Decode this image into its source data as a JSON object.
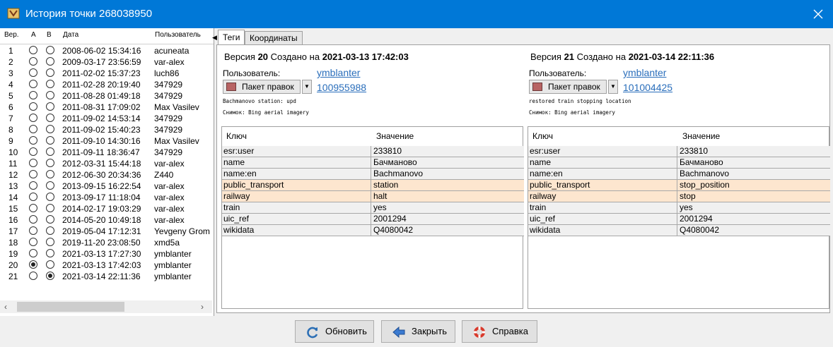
{
  "window": {
    "title": "История точки 268038950"
  },
  "history": {
    "headers": {
      "ver": "Вер.",
      "a": "A",
      "b": "B",
      "date": "Дата",
      "user": "Пользователь"
    },
    "rows": [
      {
        "ver": "1",
        "date": "2008-06-02 15:34:16",
        "user": "acuneata",
        "a": false,
        "b": false
      },
      {
        "ver": "2",
        "date": "2009-03-17 23:56:59",
        "user": "var-alex",
        "a": false,
        "b": false
      },
      {
        "ver": "3",
        "date": "2011-02-02 15:37:23",
        "user": "luch86",
        "a": false,
        "b": false
      },
      {
        "ver": "4",
        "date": "2011-02-28 20:19:40",
        "user": "347929",
        "a": false,
        "b": false
      },
      {
        "ver": "5",
        "date": "2011-08-28 01:49:18",
        "user": "347929",
        "a": false,
        "b": false
      },
      {
        "ver": "6",
        "date": "2011-08-31 17:09:02",
        "user": "Max Vasilev",
        "a": false,
        "b": false
      },
      {
        "ver": "7",
        "date": "2011-09-02 14:53:14",
        "user": "347929",
        "a": false,
        "b": false
      },
      {
        "ver": "8",
        "date": "2011-09-02 15:40:23",
        "user": "347929",
        "a": false,
        "b": false
      },
      {
        "ver": "9",
        "date": "2011-09-10 14:30:16",
        "user": "Max Vasilev",
        "a": false,
        "b": false
      },
      {
        "ver": "10",
        "date": "2011-09-11 18:36:47",
        "user": "347929",
        "a": false,
        "b": false
      },
      {
        "ver": "11",
        "date": "2012-03-31 15:44:18",
        "user": "var-alex",
        "a": false,
        "b": false
      },
      {
        "ver": "12",
        "date": "2012-06-30 20:34:36",
        "user": "Z440",
        "a": false,
        "b": false
      },
      {
        "ver": "13",
        "date": "2013-09-15 16:22:54",
        "user": "var-alex",
        "a": false,
        "b": false
      },
      {
        "ver": "14",
        "date": "2013-09-17 11:18:04",
        "user": "var-alex",
        "a": false,
        "b": false
      },
      {
        "ver": "15",
        "date": "2014-02-17 19:03:29",
        "user": "var-alex",
        "a": false,
        "b": false
      },
      {
        "ver": "16",
        "date": "2014-05-20 10:49:18",
        "user": "var-alex",
        "a": false,
        "b": false
      },
      {
        "ver": "17",
        "date": "2019-05-04 17:12:31",
        "user": "Yevgeny Grom",
        "a": false,
        "b": false
      },
      {
        "ver": "18",
        "date": "2019-11-20 23:08:50",
        "user": "xmd5a",
        "a": false,
        "b": false
      },
      {
        "ver": "19",
        "date": "2021-03-13 17:27:30",
        "user": "ymblanter",
        "a": false,
        "b": false
      },
      {
        "ver": "20",
        "date": "2021-03-13 17:42:03",
        "user": "ymblanter",
        "a": true,
        "b": false
      },
      {
        "ver": "21",
        "date": "2021-03-14 22:11:36",
        "user": "ymblanter",
        "a": false,
        "b": true
      }
    ]
  },
  "tabs": [
    {
      "label": "Теги",
      "active": true
    },
    {
      "label": "Координаты",
      "active": false
    }
  ],
  "left_version": {
    "prefix": "Версия",
    "number": "20",
    "created_label": "Создано на",
    "datetime": "2021-03-13 17:42:03",
    "user_label": "Пользователь:",
    "user": "ymblanter",
    "changeset_label": "Пакет правок",
    "changeset_id": "100955988",
    "comment": "Bachmanovo station: upd",
    "source": "Снимок: Bing aerial imagery"
  },
  "right_version": {
    "prefix": "Версия",
    "number": "21",
    "created_label": "Создано на",
    "datetime": "2021-03-14 22:11:36",
    "user_label": "Пользователь:",
    "user": "ymblanter",
    "changeset_label": "Пакет правок",
    "changeset_id": "101004425",
    "comment": "restored train stopping location",
    "source": "Снимок: Bing aerial imagery"
  },
  "tag_headers": {
    "key": "Ключ",
    "value": "Значение"
  },
  "left_tags": [
    {
      "k": "esr:user",
      "v": "233810",
      "diff": false
    },
    {
      "k": "name",
      "v": "Бачманово",
      "diff": false
    },
    {
      "k": "name:en",
      "v": "Bachmanovo",
      "diff": false
    },
    {
      "k": "public_transport",
      "v": "station",
      "diff": true
    },
    {
      "k": "railway",
      "v": "halt",
      "diff": true
    },
    {
      "k": "train",
      "v": "yes",
      "diff": false
    },
    {
      "k": "uic_ref",
      "v": "2001294",
      "diff": false
    },
    {
      "k": "wikidata",
      "v": "Q4080042",
      "diff": false
    }
  ],
  "right_tags": [
    {
      "k": "esr:user",
      "v": "233810",
      "diff": false
    },
    {
      "k": "name",
      "v": "Бачманово",
      "diff": false
    },
    {
      "k": "name:en",
      "v": "Bachmanovo",
      "diff": false
    },
    {
      "k": "public_transport",
      "v": "stop_position",
      "diff": true
    },
    {
      "k": "railway",
      "v": "stop",
      "diff": true
    },
    {
      "k": "train",
      "v": "yes",
      "diff": false
    },
    {
      "k": "uic_ref",
      "v": "2001294",
      "diff": false
    },
    {
      "k": "wikidata",
      "v": "Q4080042",
      "diff": false
    }
  ],
  "buttons": {
    "refresh": "Обновить",
    "close": "Закрыть",
    "help": "Справка"
  },
  "colors": {
    "titlebar": "#0078d7",
    "diff_row": "#fde6cf",
    "link": "#2a6ebb"
  }
}
